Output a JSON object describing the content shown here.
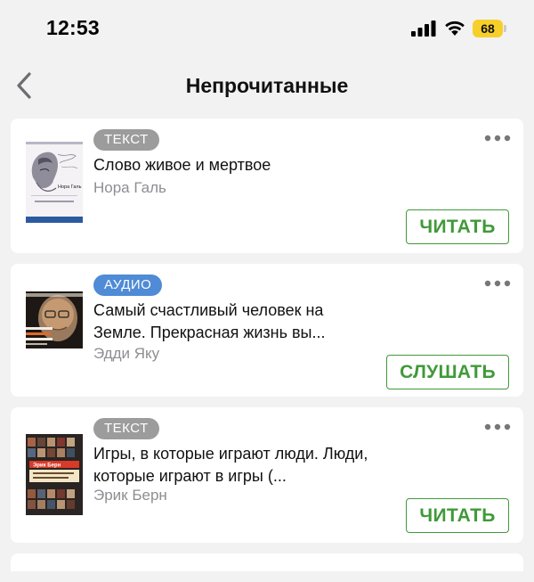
{
  "status_bar": {
    "time": "12:53",
    "battery": "68",
    "icons": [
      "signal-icon",
      "wifi-icon",
      "battery-icon"
    ]
  },
  "header": {
    "title": "Непрочитанные",
    "back_icon": "chevron-left-icon"
  },
  "colors": {
    "background": "#f2f2f2",
    "card": "#ffffff",
    "accent_green": "#3f9a38",
    "badge_text": "#9c9c9c",
    "badge_audio": "#4f8bd6",
    "battery": "#f7cf2b"
  },
  "books": [
    {
      "badge": "ТЕКСТ",
      "title": "Слово живое и мертвое",
      "author": "Нора Галь",
      "action": "ЧИТАТЬ",
      "cover_text": "Нора Галь"
    },
    {
      "badge": "АУДИО",
      "title": "Самый счастливый человек на Земле. Прекрасная жизнь вы...",
      "author": "Эдди Яку",
      "action": "СЛУШАТЬ"
    },
    {
      "badge": "ТЕКСТ",
      "title": "Игры, в которые играют люди. Люди, которые играют в игры (...",
      "author": "Эрик Берн",
      "action": "ЧИТАТЬ",
      "cover_text": "Эрик Берн"
    }
  ]
}
